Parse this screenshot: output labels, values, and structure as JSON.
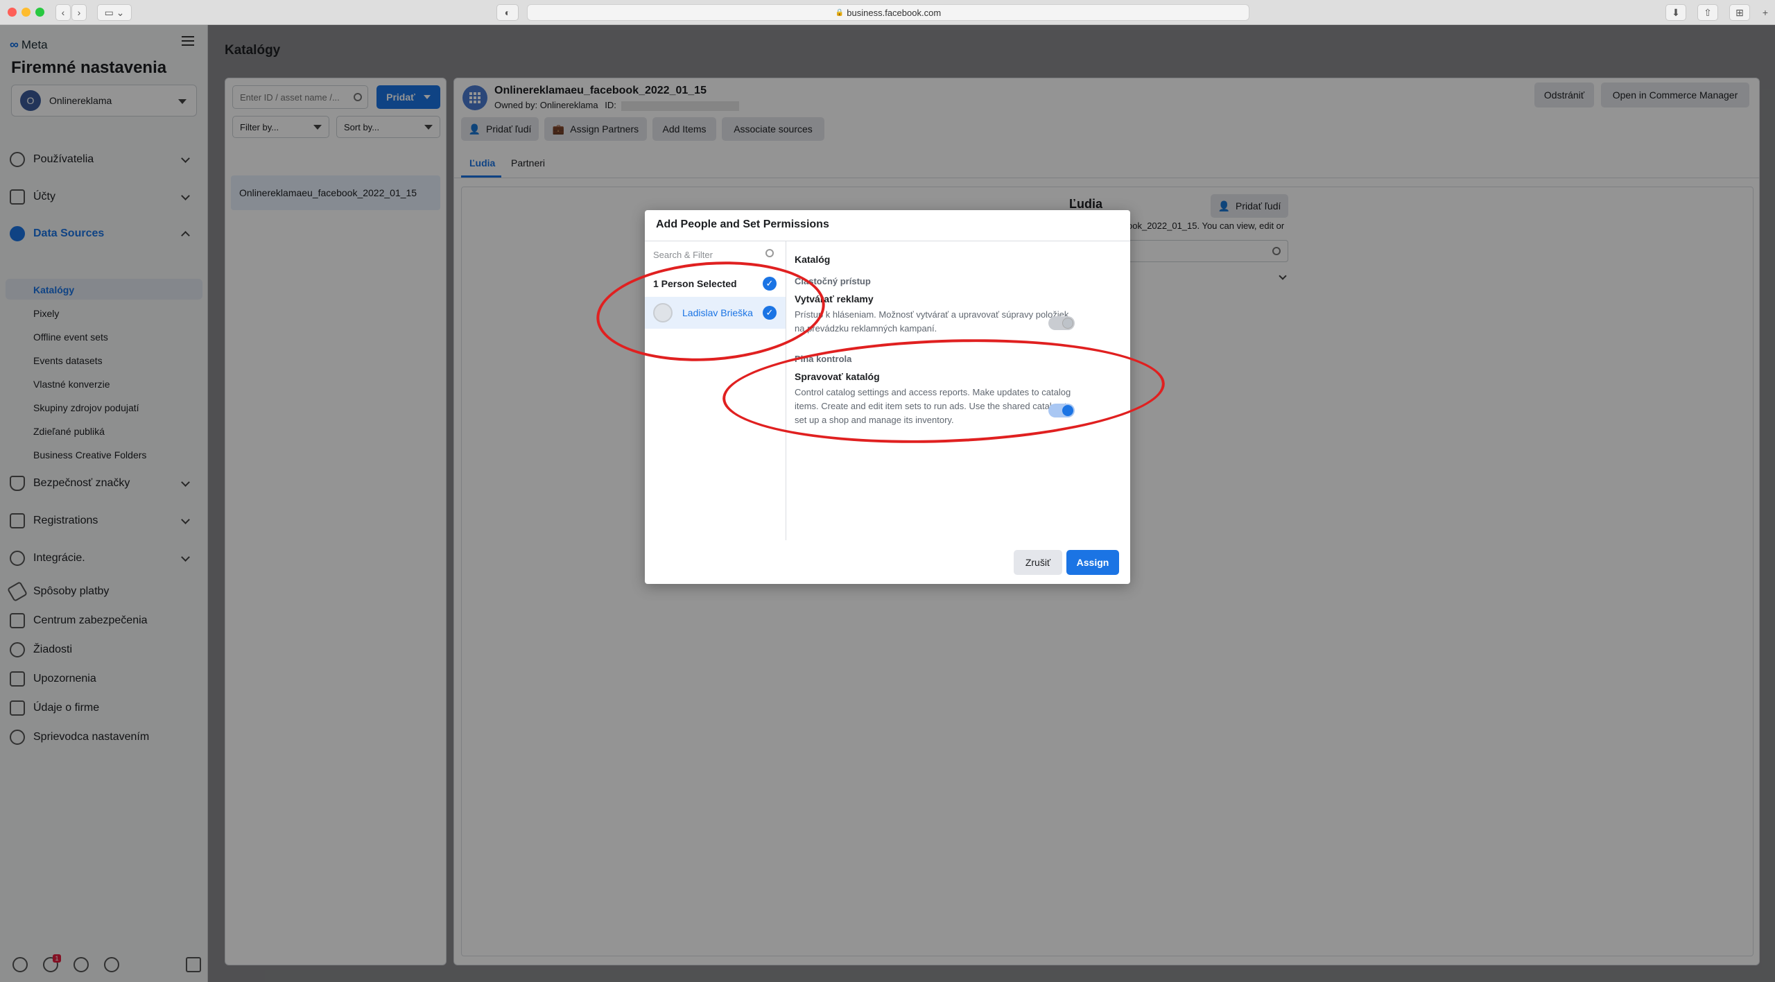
{
  "browser": {
    "url": "business.facebook.com"
  },
  "sidebar": {
    "brand": "Meta",
    "title": "Firemné nastavenia",
    "account": {
      "initial": "O",
      "name": "Onlinereklama"
    },
    "items": [
      {
        "label": "Používatelia",
        "icon": "people-icon"
      },
      {
        "label": "Účty",
        "icon": "accounts-icon"
      },
      {
        "label": "Data Sources",
        "icon": "data-sources-icon"
      },
      {
        "label": "Bezpečnosť značky",
        "icon": "shield-icon"
      },
      {
        "label": "Registrations",
        "icon": "registrations-icon"
      },
      {
        "label": "Integrácie.",
        "icon": "integrations-icon"
      },
      {
        "label": "Spôsoby platby",
        "icon": "payment-icon"
      },
      {
        "label": "Centrum zabezpečenia",
        "icon": "lock-icon"
      },
      {
        "label": "Žiadosti",
        "icon": "requests-icon"
      },
      {
        "label": "Upozornenia",
        "icon": "notifications-icon"
      },
      {
        "label": "Údaje o firme",
        "icon": "business-info-icon"
      },
      {
        "label": "Sprievodca nastavením",
        "icon": "help-icon"
      }
    ],
    "data_sources_sub": [
      "Katalógy",
      "Pixely",
      "Offline event sets",
      "Events datasets",
      "Vlastné konverzie",
      "Skupiny zdrojov podujatí",
      "Zdieľané publiká",
      "Business Creative Folders"
    ],
    "notif_count": "1"
  },
  "main": {
    "title": "Katalógy",
    "search_placeholder": "Enter ID / asset name /...",
    "add_button": "Pridať",
    "filter_label": "Filter by...",
    "sort_label": "Sort by...",
    "list_item": "Onlinereklamaeu_facebook_2022_01_15"
  },
  "detail": {
    "name": "Onlinereklamaeu_facebook_2022_01_15",
    "owned_by": "Owned by: Onlinereklama",
    "id_label": "ID:",
    "remove_button": "Odstrániť",
    "commerce_button": "Open in Commerce Manager",
    "actions": [
      "Pridať ľudí",
      "Assign Partners",
      "Add Items",
      "Associate sources"
    ],
    "tabs": [
      "Ľudia",
      "Partneri"
    ],
    "section_title": "Ľudia",
    "add_people_button": "Pridať ľudí",
    "desc_fragment": "ook_2022_01_15. You can view, edit or"
  },
  "modal": {
    "title": "Add People and Set Permissions",
    "search_placeholder": "Search & Filter",
    "selected_label": "1 Person Selected",
    "person_name": "Ladislav Brieška",
    "catalog_heading": "Katalóg",
    "partial_access": "Čiastočný prístup",
    "create_ads_title": "Vytvárať reklamy",
    "create_ads_desc": "Prístup k hláseniam. Možnosť vytvárať a upravovať súpravy položiek na prevádzku reklamných kampaní.",
    "full_control": "Plná kontrola",
    "manage_catalog_title": "Spravovať katalóg",
    "manage_catalog_desc": "Control catalog settings and access reports. Make updates to catalog items. Create and edit item sets to run ads. Use the shared catalog to set up a shop and manage its inventory.",
    "create_ads_enabled": false,
    "manage_catalog_enabled": true,
    "cancel_button": "Zrušiť",
    "assign_button": "Assign"
  },
  "colors": {
    "accent": "#1b74e4",
    "annotation": "#e02020"
  }
}
